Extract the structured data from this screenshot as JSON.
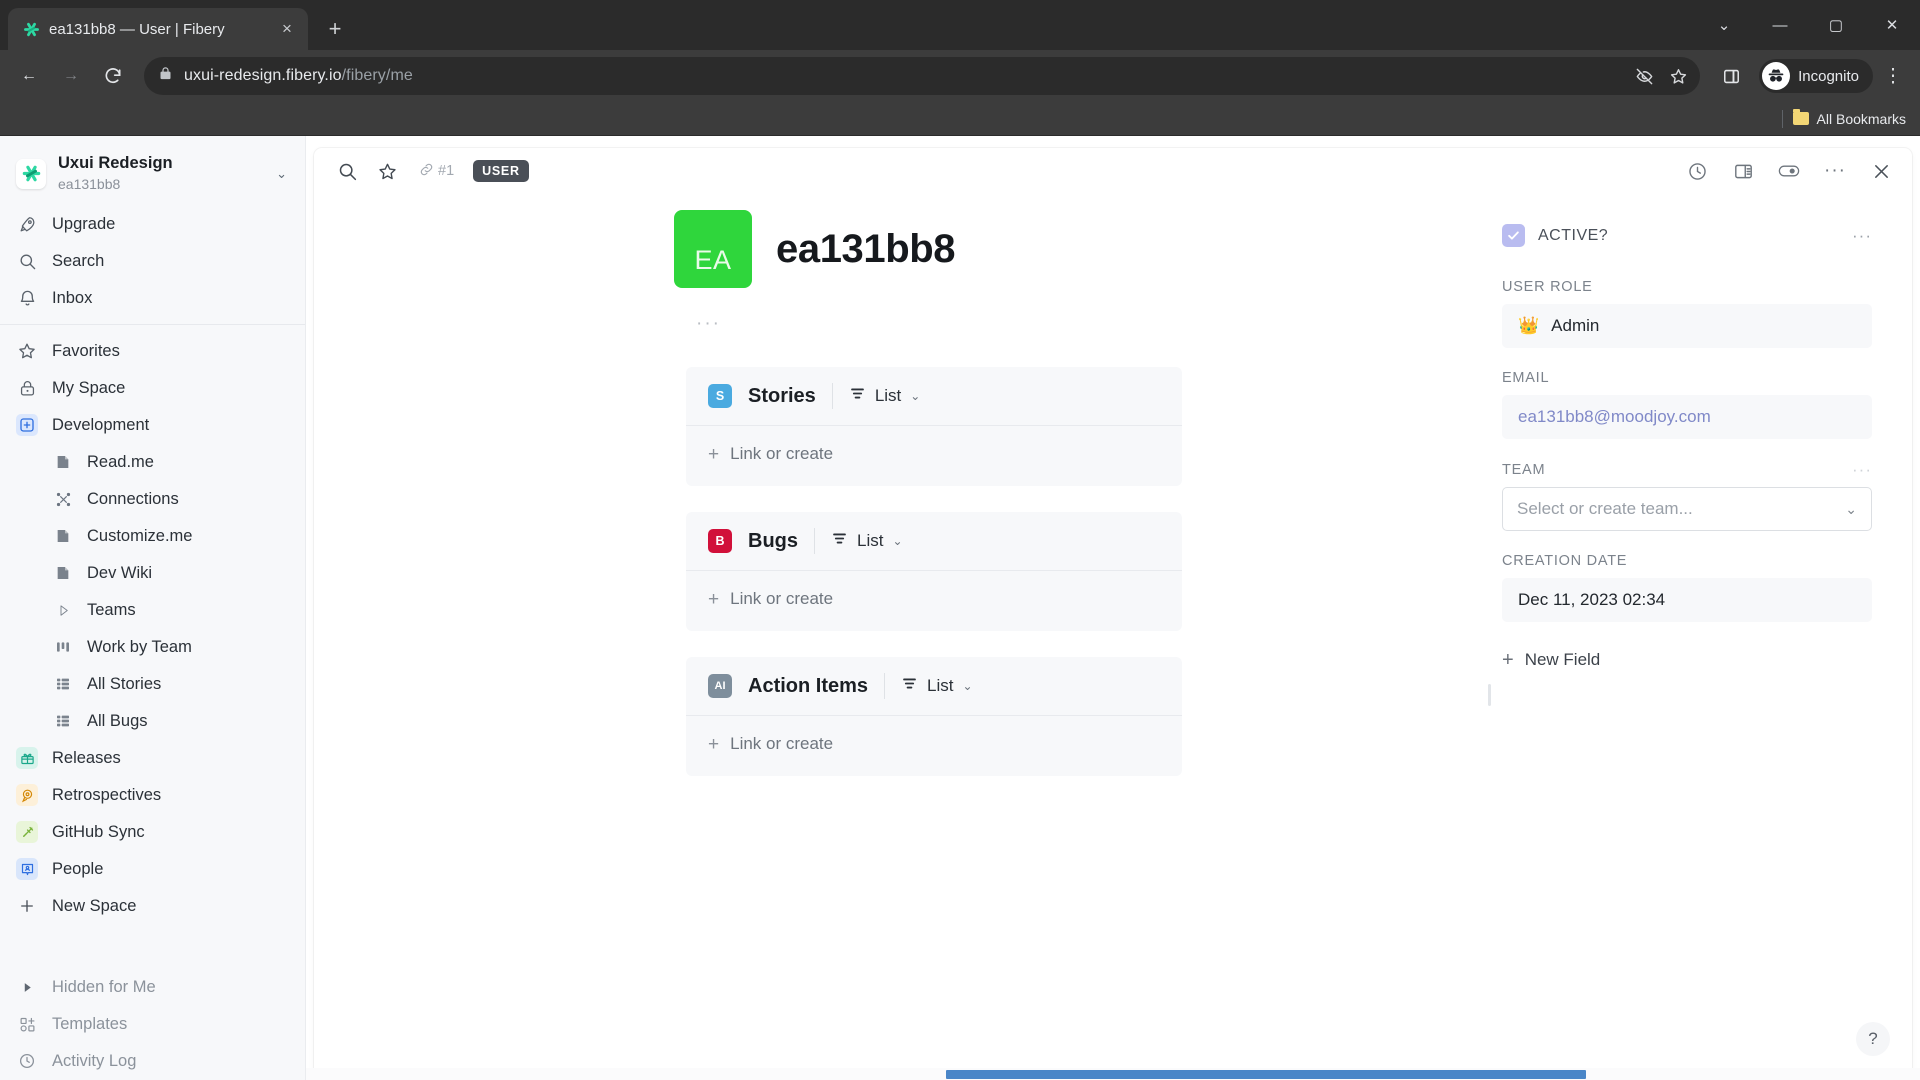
{
  "browser": {
    "tab": {
      "title": "ea131bb8 — User | Fibery",
      "favicon": "fibery-logo-icon",
      "close": "×"
    },
    "new_tab_label": "+",
    "window_controls": {
      "minimize_all": "⌄",
      "minimize": "—",
      "maximize": "▢",
      "close": "✕"
    },
    "nav": {
      "back": "←",
      "forward": "→",
      "reload": "⟳"
    },
    "omnibox": {
      "lock": "site-lock-icon",
      "url_host": "uxui-redesign.fibery.io",
      "url_path": "/fibery/me",
      "tracking_protection": "eye-off-icon",
      "bookmark": "star-icon"
    },
    "toolbar_right": {
      "side_panel": "side-panel-icon",
      "incognito_label": "Incognito",
      "menu": "⋮"
    },
    "bookmarks_bar": {
      "all_bookmarks": "All Bookmarks"
    }
  },
  "sidebar": {
    "workspace": {
      "name": "Uxui Redesign",
      "subtitle": "ea131bb8",
      "caret": "⌄"
    },
    "top_items": [
      {
        "label": "Upgrade",
        "icon": "rocket-icon"
      },
      {
        "label": "Search",
        "icon": "search-icon"
      },
      {
        "label": "Inbox",
        "icon": "bell-icon"
      }
    ],
    "main_items": [
      {
        "label": "Favorites",
        "icon": "star-icon"
      },
      {
        "label": "My Space",
        "icon": "lock-icon"
      },
      {
        "label": "Development",
        "icon": "development-space-icon"
      }
    ],
    "development_children": [
      {
        "label": "Read.me",
        "icon": "document-icon"
      },
      {
        "label": "Connections",
        "icon": "connections-icon"
      },
      {
        "label": "Customize.me",
        "icon": "document-icon"
      },
      {
        "label": "Dev Wiki",
        "icon": "document-icon"
      },
      {
        "label": "Teams",
        "icon": "play-triangle-icon"
      },
      {
        "label": "Work by Team",
        "icon": "columns-icon"
      },
      {
        "label": "All Stories",
        "icon": "grid-icon"
      },
      {
        "label": "All Bugs",
        "icon": "grid-icon"
      }
    ],
    "spaces": [
      {
        "label": "Releases",
        "icon": "gift-icon",
        "color": "#1aa78a",
        "bg": "#d8f3ec"
      },
      {
        "label": "Retrospectives",
        "icon": "retro-icon",
        "color": "#d48806",
        "bg": "#fdf0d9"
      },
      {
        "label": "GitHub Sync",
        "icon": "sync-icon",
        "color": "#79b33a",
        "bg": "#e9f5d9"
      },
      {
        "label": "People",
        "icon": "people-icon",
        "color": "#2f6fe0",
        "bg": "#d9e6fb"
      }
    ],
    "new_space": {
      "label": "New Space",
      "icon": "plus-icon"
    },
    "bottom_items": [
      {
        "label": "Hidden for Me",
        "icon": "triangle-right-icon"
      },
      {
        "label": "Templates",
        "icon": "templates-icon"
      },
      {
        "label": "Activity Log",
        "icon": "clock-icon"
      }
    ]
  },
  "entity": {
    "toolbar": {
      "search": "search-icon",
      "favorite": "star-icon",
      "ref_link_icon": "link-icon",
      "ref_number": "#1",
      "type_badge": "USER",
      "history": "history-clock-icon",
      "layout": "split-layout-icon",
      "watch": "toggle-eye-icon",
      "more": "···",
      "close": "✕"
    },
    "avatar_initials": "EA",
    "avatar_color": "#2fd63c",
    "title": "ea131bb8",
    "description_placeholder": "···",
    "collections": [
      {
        "name": "Stories",
        "icon_letter": "S",
        "icon_color": "#4aaae0",
        "view_label": "List",
        "view_icon": "list-view-icon",
        "caret": "⌄",
        "empty_action": "Link or create",
        "empty_plus": "+"
      },
      {
        "name": "Bugs",
        "icon_letter": "B",
        "icon_color": "#d1103a",
        "view_label": "List",
        "view_icon": "list-view-icon",
        "caret": "⌄",
        "empty_action": "Link or create",
        "empty_plus": "+"
      },
      {
        "name": "Action Items",
        "icon_letter": "AI",
        "icon_color": "#7e8e9c",
        "view_label": "List",
        "view_icon": "list-view-icon",
        "caret": "⌄",
        "empty_action": "Link or create",
        "empty_plus": "+"
      }
    ]
  },
  "fields_panel": {
    "active": {
      "label": "ACTIVE?",
      "checked": true,
      "check_glyph": "✓",
      "more": "···"
    },
    "user_role": {
      "label": "USER ROLE",
      "value": "Admin",
      "emoji": "👑"
    },
    "email": {
      "label": "EMAIL",
      "value": "ea131bb8@moodjoy.com"
    },
    "team": {
      "label": "TEAM",
      "placeholder": "Select or create team...",
      "caret": "⌄",
      "more": "···"
    },
    "creation_date": {
      "label": "CREATION DATE",
      "value": "Dec 11, 2023 02:34"
    },
    "new_field": {
      "label": "New Field",
      "plus": "+"
    }
  },
  "overlay": {
    "help": "?"
  }
}
